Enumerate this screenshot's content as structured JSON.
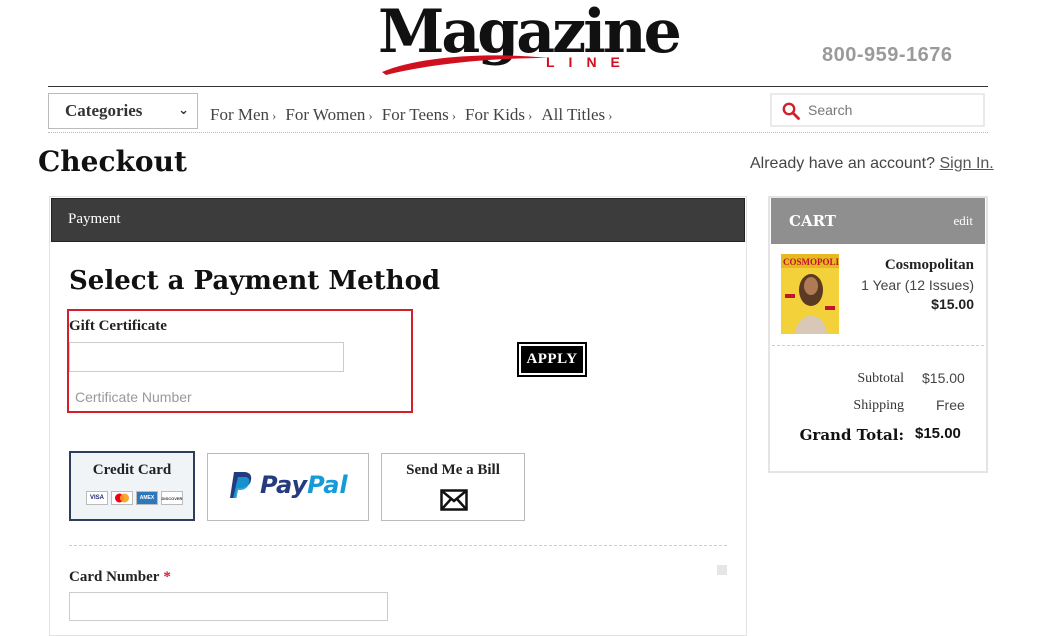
{
  "header": {
    "logo_word": "Magazine",
    "logo_sub": "LINE",
    "phone": "800-959-1676"
  },
  "nav": {
    "categories_label": "Categories",
    "items": [
      {
        "label": "For Men"
      },
      {
        "label": "For Women"
      },
      {
        "label": "For Teens"
      },
      {
        "label": "For Kids"
      },
      {
        "label": "All Titles"
      }
    ],
    "search_placeholder": "Search"
  },
  "page": {
    "title": "Checkout",
    "account_prompt": "Already have an account?",
    "sign_in": "Sign In."
  },
  "payment": {
    "panel_title": "Payment",
    "section_title": "Select a Payment Method",
    "gift_label": "Gift Certificate",
    "gift_help": "Certificate Number",
    "apply": "APPLY",
    "methods": {
      "credit_card": "Credit Card",
      "card_brands": [
        "VISA",
        "MC",
        "AMEX",
        "DISCOVER"
      ],
      "paypal": "PayPal",
      "bill": "Send Me a Bill"
    },
    "card_number_label": "Card Number",
    "required_mark": "*"
  },
  "cart": {
    "title": "CART",
    "edit": "edit",
    "item": {
      "name": "Cosmopolitan",
      "term": "1 Year (12 Issues)",
      "price": "$15.00",
      "cover_text": "COSMOPOLITAN"
    },
    "subtotal_label": "Subtotal",
    "subtotal": "$15.00",
    "shipping_label": "Shipping",
    "shipping": "Free",
    "grand_total_label": "Grand Total:",
    "grand_total": "$15.00"
  },
  "colors": {
    "accent_red": "#d21f2a",
    "panel_header": "#3c3c3c",
    "cart_header": "#8f8f8f",
    "paypal_dark": "#253b80",
    "paypal_light": "#179bd7"
  }
}
